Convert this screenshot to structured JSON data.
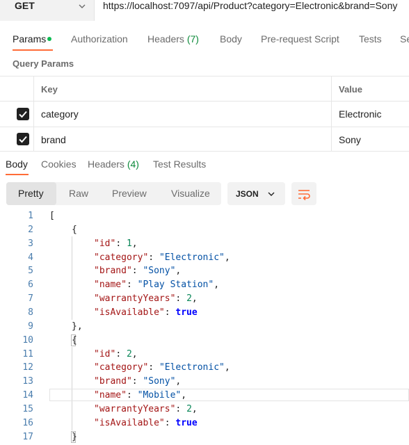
{
  "request": {
    "method": "GET",
    "url": "https://localhost:7097/api/Product?category=Electronic&brand=Sony"
  },
  "request_tabs": [
    {
      "label": "Params",
      "active": true
    },
    {
      "label": "Authorization"
    },
    {
      "label": "Headers",
      "count": "(7)"
    },
    {
      "label": "Body"
    },
    {
      "label": "Pre-request Script"
    },
    {
      "label": "Tests"
    },
    {
      "label": "Se"
    }
  ],
  "query_params": {
    "title": "Query Params",
    "columns": {
      "key": "Key",
      "value": "Value"
    },
    "rows": [
      {
        "checked": true,
        "key": "category",
        "value": "Electronic"
      },
      {
        "checked": true,
        "key": "brand",
        "value": "Sony"
      }
    ]
  },
  "response_tabs": [
    {
      "label": "Body",
      "active": true
    },
    {
      "label": "Cookies"
    },
    {
      "label": "Headers",
      "count": "(4)"
    },
    {
      "label": "Test Results"
    }
  ],
  "view": {
    "options": [
      "Pretty",
      "Raw",
      "Preview",
      "Visualize"
    ],
    "selected": "Pretty",
    "format": "JSON"
  },
  "colors": {
    "accent": "#ff6c37",
    "active_dot": "#0cbb52",
    "count": "#0c8a3a",
    "json_key": "#a31515",
    "json_string": "#0451a5",
    "json_number": "#098658",
    "json_bool": "#0000ff",
    "line_number": "#4a7dad"
  },
  "icons": {
    "method_dropdown": "chevron-down-icon",
    "format_dropdown": "chevron-down-icon",
    "wrap": "wrap-lines-icon",
    "checkbox": "check-icon"
  },
  "code": {
    "lines": [
      {
        "n": "1",
        "indent": 0,
        "tokens": [
          {
            "t": "[",
            "c": "br"
          }
        ]
      },
      {
        "n": "2",
        "indent": 1,
        "tokens": [
          {
            "t": "{",
            "c": "br"
          }
        ]
      },
      {
        "n": "3",
        "indent": 2,
        "tokens": [
          {
            "t": "\"id\"",
            "c": "key"
          },
          {
            "t": ": ",
            "c": "br"
          },
          {
            "t": "1",
            "c": "num"
          },
          {
            "t": ",",
            "c": "br"
          }
        ]
      },
      {
        "n": "4",
        "indent": 2,
        "tokens": [
          {
            "t": "\"category\"",
            "c": "key"
          },
          {
            "t": ": ",
            "c": "br"
          },
          {
            "t": "\"Electronic\"",
            "c": "str"
          },
          {
            "t": ",",
            "c": "br"
          }
        ]
      },
      {
        "n": "5",
        "indent": 2,
        "tokens": [
          {
            "t": "\"brand\"",
            "c": "key"
          },
          {
            "t": ": ",
            "c": "br"
          },
          {
            "t": "\"Sony\"",
            "c": "str"
          },
          {
            "t": ",",
            "c": "br"
          }
        ]
      },
      {
        "n": "6",
        "indent": 2,
        "tokens": [
          {
            "t": "\"name\"",
            "c": "key"
          },
          {
            "t": ": ",
            "c": "br"
          },
          {
            "t": "\"Play Station\"",
            "c": "str"
          },
          {
            "t": ",",
            "c": "br"
          }
        ]
      },
      {
        "n": "7",
        "indent": 2,
        "tokens": [
          {
            "t": "\"warrantyYears\"",
            "c": "key"
          },
          {
            "t": ": ",
            "c": "br"
          },
          {
            "t": "2",
            "c": "num"
          },
          {
            "t": ",",
            "c": "br"
          }
        ]
      },
      {
        "n": "8",
        "indent": 2,
        "tokens": [
          {
            "t": "\"isAvailable\"",
            "c": "key"
          },
          {
            "t": ": ",
            "c": "br"
          },
          {
            "t": "true",
            "c": "kw"
          }
        ]
      },
      {
        "n": "9",
        "indent": 1,
        "tokens": [
          {
            "t": "},",
            "c": "br"
          }
        ]
      },
      {
        "n": "10",
        "indent": 1,
        "tokens": [
          {
            "t": "{",
            "c": "br"
          }
        ]
      },
      {
        "n": "11",
        "indent": 2,
        "tokens": [
          {
            "t": "\"id\"",
            "c": "key"
          },
          {
            "t": ": ",
            "c": "br"
          },
          {
            "t": "2",
            "c": "num"
          },
          {
            "t": ",",
            "c": "br"
          }
        ]
      },
      {
        "n": "12",
        "indent": 2,
        "tokens": [
          {
            "t": "\"category\"",
            "c": "key"
          },
          {
            "t": ": ",
            "c": "br"
          },
          {
            "t": "\"Electronic\"",
            "c": "str"
          },
          {
            "t": ",",
            "c": "br"
          }
        ]
      },
      {
        "n": "13",
        "indent": 2,
        "tokens": [
          {
            "t": "\"brand\"",
            "c": "key"
          },
          {
            "t": ": ",
            "c": "br"
          },
          {
            "t": "\"Sony\"",
            "c": "str"
          },
          {
            "t": ",",
            "c": "br"
          }
        ]
      },
      {
        "n": "14",
        "indent": 2,
        "tokens": [
          {
            "t": "\"name\"",
            "c": "key"
          },
          {
            "t": ": ",
            "c": "br"
          },
          {
            "t": "\"Mobile\"",
            "c": "str"
          },
          {
            "t": ",",
            "c": "br"
          }
        ]
      },
      {
        "n": "15",
        "indent": 2,
        "tokens": [
          {
            "t": "\"warrantyYears\"",
            "c": "key"
          },
          {
            "t": ": ",
            "c": "br"
          },
          {
            "t": "2",
            "c": "num"
          },
          {
            "t": ",",
            "c": "br"
          }
        ]
      },
      {
        "n": "16",
        "indent": 2,
        "tokens": [
          {
            "t": "\"isAvailable\"",
            "c": "key"
          },
          {
            "t": ": ",
            "c": "br"
          },
          {
            "t": "true",
            "c": "kw"
          }
        ]
      },
      {
        "n": "17",
        "indent": 1,
        "tokens": [
          {
            "t": "}",
            "c": "br"
          }
        ]
      }
    ]
  }
}
